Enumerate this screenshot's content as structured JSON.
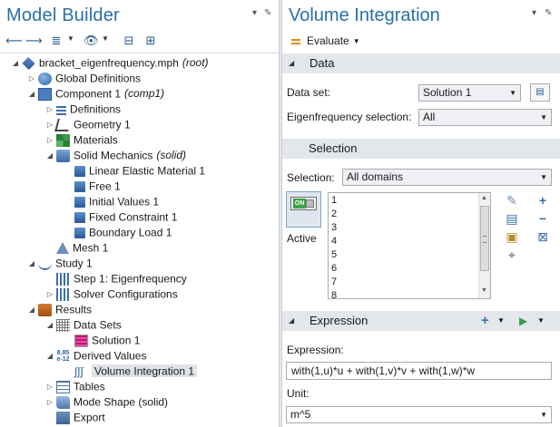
{
  "left_pane": {
    "title": "Model Builder",
    "tree": [
      {
        "label": "bracket_eigenfrequency.mph",
        "suffix": "(root)",
        "icon": "model-root-icon",
        "depth": 0,
        "twisty": "expanded"
      },
      {
        "label": "Global Definitions",
        "suffix": "",
        "icon": "globe-icon",
        "depth": 1,
        "twisty": "collapsed"
      },
      {
        "label": "Component 1",
        "suffix": "(comp1)",
        "icon": "component-icon",
        "depth": 1,
        "twisty": "expanded"
      },
      {
        "label": "Definitions",
        "suffix": "",
        "icon": "definitions-icon",
        "depth": 2,
        "twisty": "collapsed"
      },
      {
        "label": "Geometry 1",
        "suffix": "",
        "icon": "geometry-icon",
        "depth": 2,
        "twisty": "collapsed"
      },
      {
        "label": "Materials",
        "suffix": "",
        "icon": "materials-icon",
        "depth": 2,
        "twisty": "collapsed"
      },
      {
        "label": "Solid Mechanics",
        "suffix": "(solid)",
        "icon": "solid-mechanics-icon",
        "depth": 2,
        "twisty": "expanded"
      },
      {
        "label": "Linear Elastic Material 1",
        "suffix": "",
        "icon": "linear-elastic-icon",
        "depth": 3,
        "twisty": "none"
      },
      {
        "label": "Free 1",
        "suffix": "",
        "icon": "free-icon",
        "depth": 3,
        "twisty": "none"
      },
      {
        "label": "Initial Values 1",
        "suffix": "",
        "icon": "initial-values-icon",
        "depth": 3,
        "twisty": "none"
      },
      {
        "label": "Fixed Constraint 1",
        "suffix": "",
        "icon": "fixed-constraint-icon",
        "depth": 3,
        "twisty": "none"
      },
      {
        "label": "Boundary Load 1",
        "suffix": "",
        "icon": "boundary-load-icon",
        "depth": 3,
        "twisty": "none"
      },
      {
        "label": "Mesh 1",
        "suffix": "",
        "icon": "mesh-icon",
        "depth": 2,
        "twisty": "none"
      },
      {
        "label": "Study 1",
        "suffix": "",
        "icon": "study-icon",
        "depth": 1,
        "twisty": "expanded"
      },
      {
        "label": "Step 1: Eigenfrequency",
        "suffix": "",
        "icon": "study-step-icon",
        "depth": 2,
        "twisty": "none"
      },
      {
        "label": "Solver Configurations",
        "suffix": "",
        "icon": "solver-configurations-icon",
        "depth": 2,
        "twisty": "collapsed"
      },
      {
        "label": "Results",
        "suffix": "",
        "icon": "results-icon",
        "depth": 1,
        "twisty": "expanded"
      },
      {
        "label": "Data Sets",
        "suffix": "",
        "icon": "data-sets-icon",
        "depth": 2,
        "twisty": "expanded"
      },
      {
        "label": "Solution 1",
        "suffix": "",
        "icon": "solution-icon",
        "depth": 3,
        "twisty": "none"
      },
      {
        "label": "Derived Values",
        "suffix": "",
        "icon": "derived-values-icon",
        "depth": 2,
        "twisty": "expanded"
      },
      {
        "label": "Volume Integration 1",
        "suffix": "",
        "icon": "volume-integration-icon",
        "depth": 3,
        "twisty": "none",
        "selected": true
      },
      {
        "label": "Tables",
        "suffix": "",
        "icon": "tables-icon",
        "depth": 2,
        "twisty": "collapsed"
      },
      {
        "label": "Mode Shape (solid)",
        "suffix": "",
        "icon": "mode-shape-icon",
        "depth": 2,
        "twisty": "collapsed"
      },
      {
        "label": "Export",
        "suffix": "",
        "icon": "export-icon",
        "depth": 2,
        "twisty": "none"
      }
    ]
  },
  "right_pane": {
    "title": "Volume Integration",
    "evaluate_label": "Evaluate",
    "data_section": {
      "title": "Data",
      "dataset_label": "Data set:",
      "dataset_value": "Solution 1",
      "eigen_label": "Eigenfrequency selection:",
      "eigen_value": "All"
    },
    "selection_section": {
      "title": "Selection",
      "selection_label": "Selection:",
      "selection_value": "All domains",
      "active_toggle": "ON",
      "active_label": "Active",
      "items": [
        "1",
        "2",
        "3",
        "4",
        "5",
        "6",
        "7",
        "8"
      ]
    },
    "expression_section": {
      "title": "Expression",
      "expression_label": "Expression:",
      "expression_value": "with(1,u)*u + with(1,v)*v + with(1,w)*w",
      "unit_label": "Unit:",
      "unit_value": "m^5"
    }
  },
  "colors": {
    "title_blue": "#2b6ea8",
    "section_header_bg": "#e3e7ec",
    "selected_row_bg": "#dfe3e8",
    "on_green": "#39a24a"
  }
}
